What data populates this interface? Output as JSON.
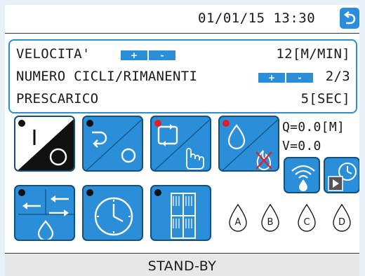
{
  "header": {
    "datetime": "01/01/15 13:30"
  },
  "params": {
    "velocita": {
      "label": "VELOCITA'",
      "value": "12[M/MIN]"
    },
    "cicli": {
      "label": "NUMERO CICLI/RIMANENTI",
      "value": "2/3"
    },
    "prescarico": {
      "label": "PRESCARICO",
      "value": "5[SEC]"
    },
    "plus": "+",
    "minus": "-"
  },
  "readouts": {
    "q": "Q=0.0[M]",
    "v": "V=0.0"
  },
  "drops": [
    "A",
    "B",
    "C",
    "D"
  ],
  "status": {
    "text": "STAND-BY"
  },
  "colors": {
    "accent": "#2a8fd8",
    "active_dot": "#e02020",
    "inactive_dot": "#1a1a1a"
  }
}
